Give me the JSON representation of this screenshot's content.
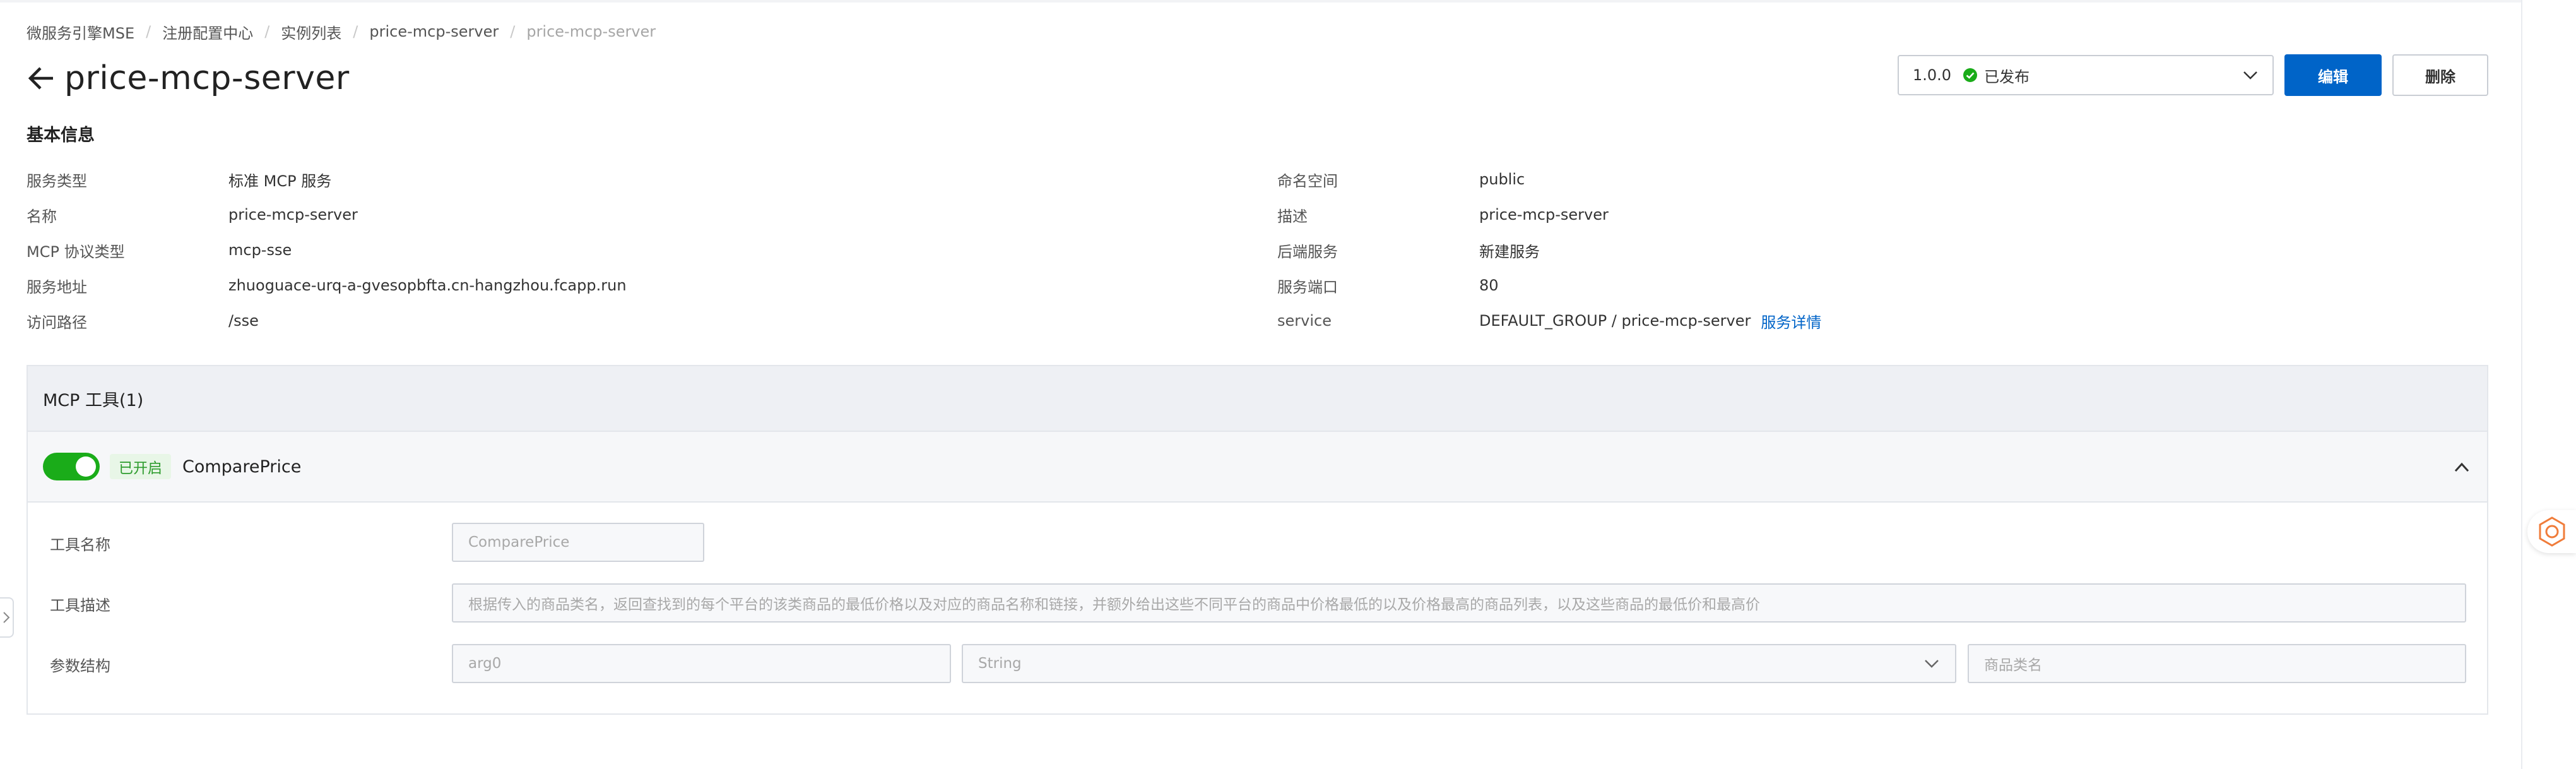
{
  "breadcrumb": [
    "微服务引擎MSE",
    "注册配置中心",
    "实例列表",
    "price-mcp-server",
    "price-mcp-server"
  ],
  "page": {
    "title": "price-mcp-server"
  },
  "actions": {
    "version": "1.0.0",
    "version_status": "已发布",
    "edit_label": "编辑",
    "delete_label": "删除"
  },
  "basic_info": {
    "title": "基本信息",
    "left": [
      {
        "label": "服务类型",
        "value": "标准 MCP 服务"
      },
      {
        "label": "名称",
        "value": "price-mcp-server"
      },
      {
        "label": "MCP 协议类型",
        "value": "mcp-sse"
      },
      {
        "label": "服务地址",
        "value": "zhuoguace-urq-a-gvesopbfta.cn-hangzhou.fcapp.run"
      },
      {
        "label": "访问路径",
        "value": "/sse"
      }
    ],
    "right": [
      {
        "label": "命名空间",
        "value": "public"
      },
      {
        "label": "描述",
        "value": "price-mcp-server"
      },
      {
        "label": "后端服务",
        "value": "新建服务"
      },
      {
        "label": "服务端口",
        "value": "80"
      },
      {
        "label": "service",
        "value": "DEFAULT_GROUP / price-mcp-server",
        "link": "服务详情"
      }
    ]
  },
  "tools": {
    "header": "MCP 工具(1)",
    "item": {
      "enabled": true,
      "status": "已开启",
      "name": "ComparePrice",
      "form": {
        "name_label": "工具名称",
        "name_value": "ComparePrice",
        "desc_label": "工具描述",
        "desc_value": "根据传入的商品类名，返回查找到的每个平台的该类商品的最低价格以及对应的商品名称和链接，并额外给出这些不同平台的商品中价格最低的以及价格最高的商品列表，以及这些商品的最低价和最高价",
        "params_label": "参数结构",
        "param_name": "arg0",
        "param_type": "String",
        "param_desc": "商品类名"
      }
    }
  },
  "colors": {
    "primary": "#0064c8",
    "success": "#1aac19"
  },
  "icons": [
    "back-arrow-icon",
    "check-circle-icon",
    "chevron-down-icon",
    "chevron-up-icon",
    "assistant-icon",
    "chevron-right-icon"
  ]
}
